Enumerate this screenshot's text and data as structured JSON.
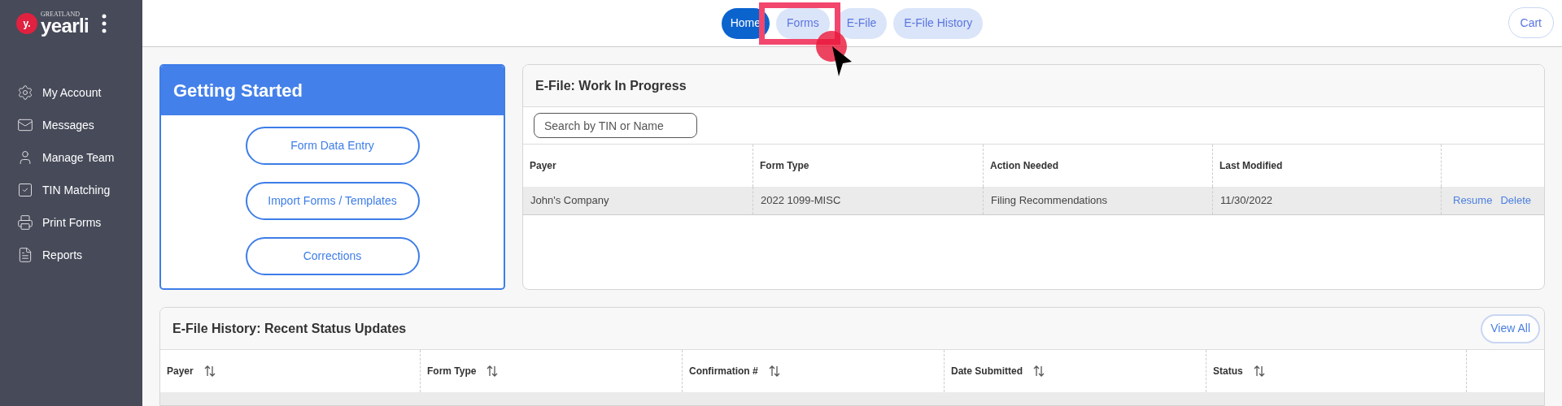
{
  "sidebar": {
    "logo": {
      "badge": "y.",
      "brand_small": "GREATLAND",
      "brand": "yearli"
    },
    "items": [
      {
        "kind": "account",
        "label": "My Account"
      },
      {
        "kind": "messages",
        "label": "Messages"
      },
      {
        "kind": "team",
        "label": "Manage Team"
      },
      {
        "kind": "tin",
        "label": "TIN Matching"
      },
      {
        "kind": "print",
        "label": "Print Forms"
      },
      {
        "kind": "reports",
        "label": "Reports"
      }
    ]
  },
  "nav": {
    "tabs": [
      {
        "label": "Home",
        "selected": true
      },
      {
        "label": "Forms",
        "selected": false
      },
      {
        "label": "E-File",
        "selected": false
      },
      {
        "label": "E-File History",
        "selected": false
      }
    ],
    "cart": "Cart"
  },
  "getting_started": {
    "title": "Getting Started",
    "buttons": [
      "Form Data Entry",
      "Import Forms / Templates",
      "Corrections"
    ]
  },
  "work_in_progress": {
    "title": "E-File: Work In Progress",
    "search": {
      "placeholder": "Search by TIN or Name"
    },
    "columns": [
      "Payer",
      "Form Type",
      "Action Needed",
      "Last Modified"
    ],
    "rows": [
      {
        "payer": "John's Company",
        "form_type": "2022 1099-MISC",
        "action_needed": "Filing Recommendations",
        "last_modified": "11/30/2022",
        "actions": [
          "Resume",
          "Delete"
        ]
      }
    ]
  },
  "history": {
    "title": "E-File History: Recent Status Updates",
    "view_all": "View All",
    "columns": [
      "Payer",
      "Form Type",
      "Confirmation #",
      "Date Submitted",
      "Status"
    ]
  }
}
